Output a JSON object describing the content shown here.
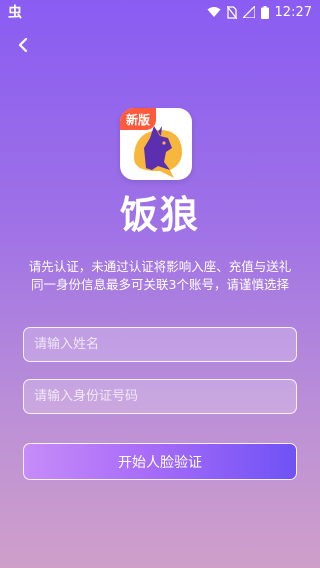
{
  "status_bar": {
    "carrier_icon": "虫",
    "time": "12:27",
    "icons": [
      "wifi-icon",
      "sim-off-icon",
      "signal-icon",
      "battery-icon"
    ]
  },
  "header": {
    "back_icon": "back-arrow-icon"
  },
  "app": {
    "badge": "新版",
    "logo_text": "饭狼",
    "icon_name": "wolf-howling-icon"
  },
  "notice": {
    "line1": "请先认证，未通过认证将影响入座、充值与送礼",
    "line2": "同一身份信息最多可关联3个账号，请谨慎选择"
  },
  "form": {
    "name_placeholder": "请输入姓名",
    "id_placeholder": "请输入身份证号码",
    "submit_label": "开始人脸验证"
  },
  "colors": {
    "bg_top": "#8a5cf2",
    "bg_bottom": "#cf9fca",
    "button_start": "#c68cf8",
    "button_end": "#6f52f5",
    "badge": "#ff5a3c",
    "wolf_dark": "#5b2fb0",
    "bubble": "#f6b73c"
  }
}
